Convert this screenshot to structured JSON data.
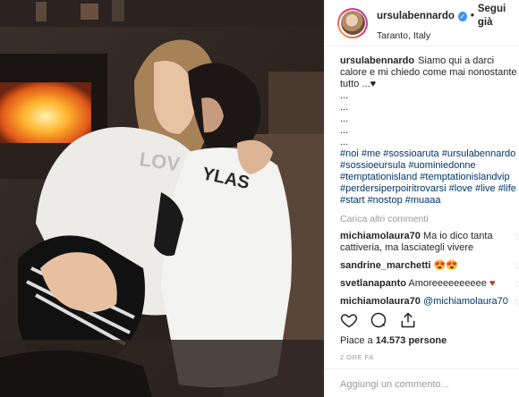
{
  "post": {
    "username": "ursulabennardo",
    "follow_label": "Segui già",
    "location": "Taranto, Italy",
    "caption_text": "Siamo qui a darci calore e mi chiedo come mai nonostante tutto ...",
    "caption_dots": [
      "...",
      "...",
      "...",
      "...",
      "..."
    ],
    "hashtags": "#noi #me #sossioaruta #ursulabennardo #sossioeursula #uominiedonne #temptationisland #temptationislandvip #perdersiperpoiritrovarsi #love #live #life #start #nostop #muaaa",
    "load_more": "Carica altri commenti",
    "comments": [
      {
        "user": "michiamolaura70",
        "text": "Ma io dico tanta cattiveria, ma lasciategli vivere"
      },
      {
        "user": "sandrine_marchetti",
        "text": "😍😍"
      },
      {
        "user": "svetlanapanto",
        "text": "Amoreeeeeeeeee"
      },
      {
        "user": "michiamolaura70",
        "text": "@michiamolaura70"
      }
    ],
    "likes_prefix": "Piace a",
    "likes_count": "14.573 persone",
    "time": "2 ORE FA",
    "add_comment_placeholder": "Aggiungi un commento..."
  },
  "photo": {
    "sweater_text_1": "LOV",
    "sweater_text_2": "YLAS"
  },
  "colors": {
    "link": "#003569",
    "verified": "#3897f0",
    "muted": "#999999"
  },
  "icons": [
    "verified-badge-icon",
    "heart-icon",
    "comment-icon",
    "share-icon",
    "red-heart-icon"
  ]
}
